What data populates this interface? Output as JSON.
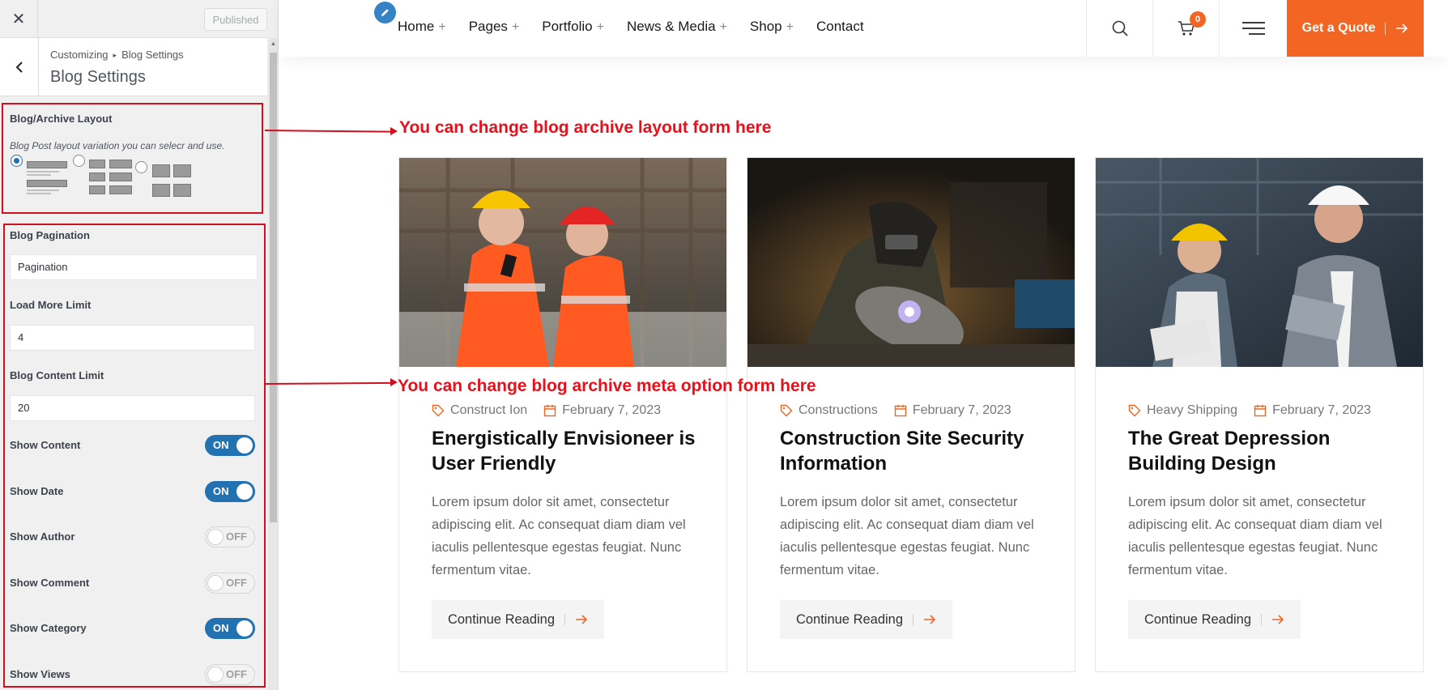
{
  "sidebar": {
    "close_icon": "close-icon",
    "published_label": "Published",
    "breadcrumb": [
      "Customizing",
      "Blog Settings"
    ],
    "title": "Blog Settings",
    "layout": {
      "label": "Blog/Archive Layout",
      "description": "Blog Post layout variation you can selecr and use.",
      "selected_index": 0
    },
    "pagination": {
      "label": "Blog Pagination",
      "value": "Pagination"
    },
    "load_more": {
      "label": "Load More Limit",
      "value": "4"
    },
    "content_limit": {
      "label": "Blog Content Limit",
      "value": "20"
    },
    "toggles": [
      {
        "label": "Show Content",
        "state": "ON"
      },
      {
        "label": "Show Date",
        "state": "ON"
      },
      {
        "label": "Show Author",
        "state": "OFF"
      },
      {
        "label": "Show Comment",
        "state": "OFF"
      },
      {
        "label": "Show Category",
        "state": "ON"
      },
      {
        "label": "Show Views",
        "state": "OFF"
      }
    ]
  },
  "annotations": {
    "layout_note": "You can change blog archive layout form here",
    "meta_note": "You can change blog archive meta option form here",
    "color": "#e8111b"
  },
  "header": {
    "nav": [
      {
        "label": "Home",
        "has_submenu": true
      },
      {
        "label": "Pages",
        "has_submenu": true
      },
      {
        "label": "Portfolio",
        "has_submenu": true
      },
      {
        "label": "News & Media",
        "has_submenu": true
      },
      {
        "label": "Shop",
        "has_submenu": true
      },
      {
        "label": "Contact",
        "has_submenu": false
      }
    ],
    "submenu_marker": "+",
    "cart_count": "0",
    "quote_label": "Get a Quote",
    "accent": "#f26522"
  },
  "posts": [
    {
      "category": "Construct Ion",
      "date": "February 7, 2023",
      "title": "Energistically Envisioneer is User Friendly",
      "excerpt": "Lorem ipsum dolor sit amet, consectetur adipiscing elit. Ac consequat diam diam vel iaculis pellentesque egestas feugiat. Nunc fermentum vitae.",
      "read_label": "Continue Reading"
    },
    {
      "category": "Constructions",
      "date": "February 7, 2023",
      "title": "Construction Site Security Information",
      "excerpt": "Lorem ipsum dolor sit amet, consectetur adipiscing elit. Ac consequat diam diam vel iaculis pellentesque egestas feugiat. Nunc fermentum vitae.",
      "read_label": "Continue Reading"
    },
    {
      "category": "Heavy Shipping",
      "date": "February 7, 2023",
      "title": "The Great Depression Building Design",
      "excerpt": "Lorem ipsum dolor sit amet, consectetur adipiscing elit. Ac consequat diam diam vel iaculis pellentesque egestas feugiat. Nunc fermentum vitae.",
      "read_label": "Continue Reading"
    }
  ]
}
